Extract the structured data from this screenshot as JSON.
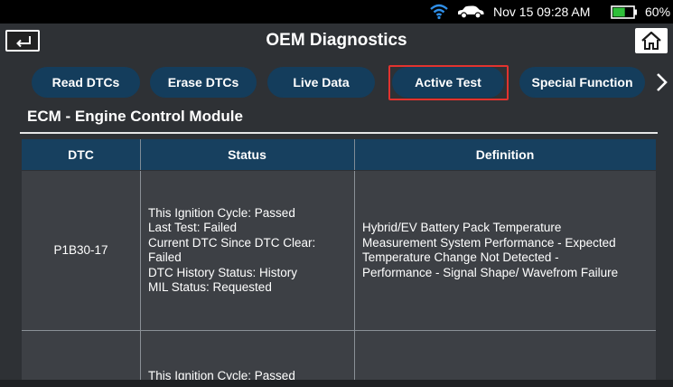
{
  "status_bar": {
    "wifi_icon": "wifi-icon",
    "vehicle_icon": "car-icon",
    "datetime": "Nov 15  09:28 AM",
    "battery_icon": "battery-icon",
    "battery_percent": "60%",
    "battery_level": 0.6
  },
  "header": {
    "back_icon": "back-arrow-icon",
    "title": "OEM Diagnostics",
    "home_icon": "home-icon"
  },
  "tabs": [
    {
      "label": "Read DTCs",
      "active": false
    },
    {
      "label": "Erase DTCs",
      "active": false
    },
    {
      "label": "Live Data",
      "active": false
    },
    {
      "label": "Active Test",
      "active": true
    },
    {
      "label": "Special Function",
      "active": false
    }
  ],
  "tabs_next_icon": "chevron-right-icon",
  "module_title": "ECM - Engine Control Module",
  "table": {
    "columns": [
      "DTC",
      "Status",
      "Definition"
    ],
    "rows": [
      {
        "dtc": "P1B30-17",
        "status": [
          "This Ignition Cycle: Passed",
          "Last Test: Failed",
          "Current DTC Since DTC Clear:",
          "Failed",
          "DTC History Status: History",
          "MIL Status: Requested"
        ],
        "definition": [
          "Hybrid/EV Battery Pack Temperature",
          "Measurement System Performance - Expected",
          "Temperature Change Not Detected -",
          "Performance - Signal Shape/ Wavefrom Failure"
        ]
      },
      {
        "dtc": "",
        "status": [
          "This Ignition Cycle: Passed"
        ],
        "definition": []
      }
    ]
  },
  "colors": {
    "background": "#2e3135",
    "tab_fill": "#143d5c",
    "table_header": "#17405f",
    "row_fill": "#3d4045",
    "active_highlight": "#e2332f",
    "battery_fill": "#2fbf3a",
    "wifi": "#2f8fe8"
  }
}
